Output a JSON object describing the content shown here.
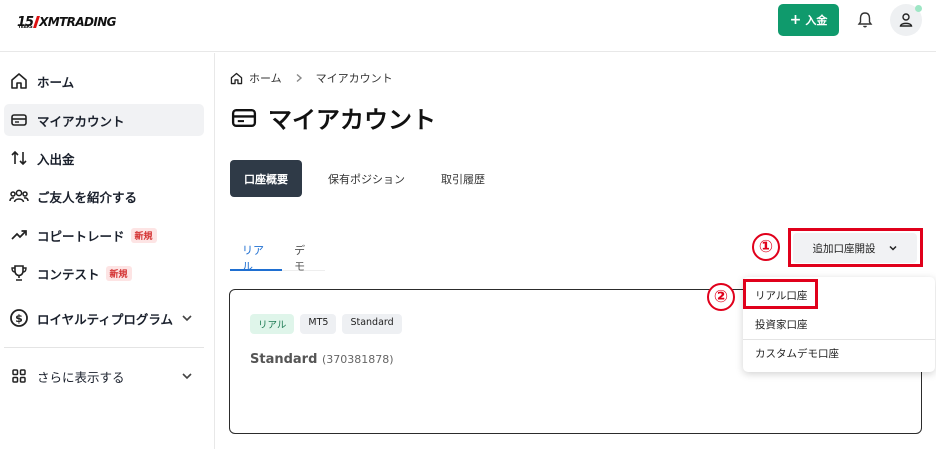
{
  "header": {
    "logo_number": "15",
    "logo_sub": "YEARS",
    "logo_text": "XMTRADING",
    "deposit_label": "入金"
  },
  "sidebar": {
    "items": [
      {
        "label": "ホーム",
        "icon": "home-icon"
      },
      {
        "label": "マイアカウント",
        "icon": "card-icon",
        "active": true
      },
      {
        "label": "入出金",
        "icon": "transfer-arrows-icon"
      },
      {
        "label": "ご友人を紹介する",
        "icon": "people-icon"
      },
      {
        "label": "コピートレード",
        "icon": "trend-up-icon",
        "badge": "新規"
      },
      {
        "label": "コンテスト",
        "icon": "trophy-icon",
        "badge": "新規"
      },
      {
        "label": "ロイヤルティプログラム",
        "icon": "dollar-circle-icon"
      },
      {
        "label": "さらに表示する",
        "icon": "grid-icon"
      }
    ]
  },
  "breadcrumb": {
    "home": "ホーム",
    "current": "マイアカウント"
  },
  "page": {
    "title": "マイアカウント"
  },
  "tabs": [
    {
      "label": "口座概要",
      "active": true
    },
    {
      "label": "保有ポジション"
    },
    {
      "label": "取引履歴"
    }
  ],
  "subtabs": [
    {
      "label": "リアル",
      "active": true
    },
    {
      "label": "デモ"
    }
  ],
  "account_card": {
    "chips": [
      "リアル",
      "MT5",
      "Standard"
    ],
    "name": "Standard",
    "id": "(370381878)"
  },
  "add_account": {
    "label": "追加口座開設",
    "options": [
      "リアル口座",
      "投資家口座",
      "カスタムデモ口座"
    ]
  },
  "annotations": {
    "step1": "①",
    "step2": "②"
  },
  "colors": {
    "deposit_green": "#0f9a6c",
    "active_tab": "#2f3a47",
    "link_blue": "#1f6fd1",
    "annotation_red": "#e0001b"
  }
}
